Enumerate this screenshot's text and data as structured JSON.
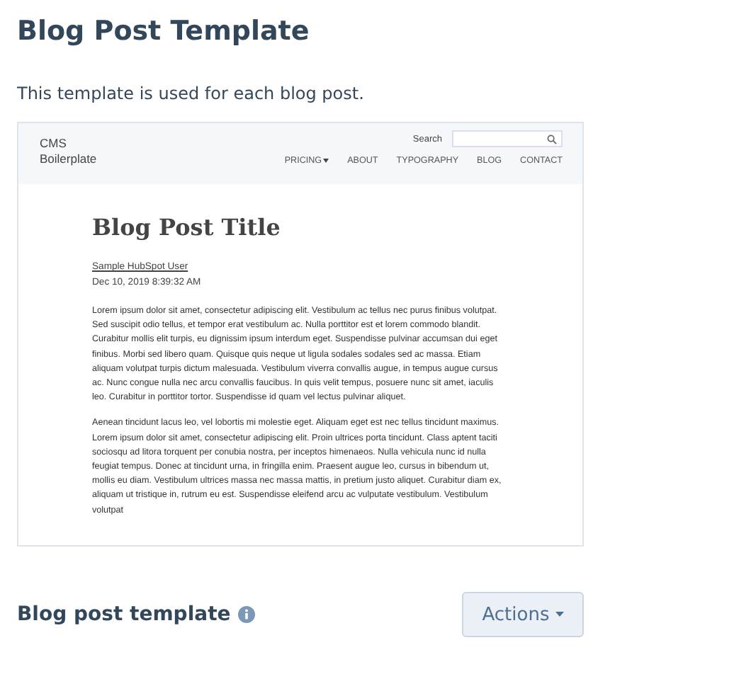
{
  "title": "Blog Post Template",
  "description": "This template is used for each blog post.",
  "preview": {
    "logo": [
      "CMS",
      "Boilerplate"
    ],
    "search_label": "Search",
    "nav": [
      {
        "label": "PRICING",
        "dropdown": true
      },
      {
        "label": "ABOUT",
        "dropdown": false
      },
      {
        "label": "TYPOGRAPHY",
        "dropdown": false
      },
      {
        "label": "BLOG",
        "dropdown": false
      },
      {
        "label": "CONTACT",
        "dropdown": false
      }
    ],
    "post_title": "Blog Post Title",
    "author": "Sample HubSpot User",
    "date": "Dec 10, 2019 8:39:32 AM",
    "paragraphs": [
      "Lorem ipsum dolor sit amet, consectetur adipiscing elit. Vestibulum ac tellus nec purus finibus volutpat. Sed suscipit odio tellus, et tempor erat vestibulum ac. Nulla porttitor est et lorem commodo blandit. Curabitur mollis elit turpis, eu dignissim ipsum interdum eget. Suspendisse pulvinar accumsan dui eget finibus. Morbi sed libero quam. Quisque quis neque ut ligula sodales sodales sed ac massa. Etiam aliquam volutpat turpis dictum malesuada. Vestibulum viverra convallis augue, in tempus augue cursus ac. Nunc congue nulla nec arcu convallis faucibus. In quis velit tempus, posuere nunc sit amet, iaculis leo. Curabitur in porttitor tortor. Suspendisse id quam vel lectus pulvinar aliquet.",
      "Aenean tincidunt lacus leo, vel lobortis mi molestie eget. Aliquam eget est nec tellus tincidunt maximus. Lorem ipsum dolor sit amet, consectetur adipiscing elit. Proin ultrices porta tincidunt. Class aptent taciti sociosqu ad litora torquent per conubia nostra, per inceptos himenaeos. Nulla vehicula nunc id nulla feugiat tempus. Donec at tincidunt urna, in fringilla enim. Praesent augue leo, cursus in bibendum ut, mollis eu diam. Vestibulum ultrices massa nec massa mattis, in pretium justo aliquet. Curabitur diam ex, aliquam ut tristique in, rutrum eu est. Suspendisse eleifend arcu ac vulputate vestibulum. Vestibulum volutpat"
    ]
  },
  "footer": {
    "label": "Blog post template",
    "button": "Actions"
  }
}
